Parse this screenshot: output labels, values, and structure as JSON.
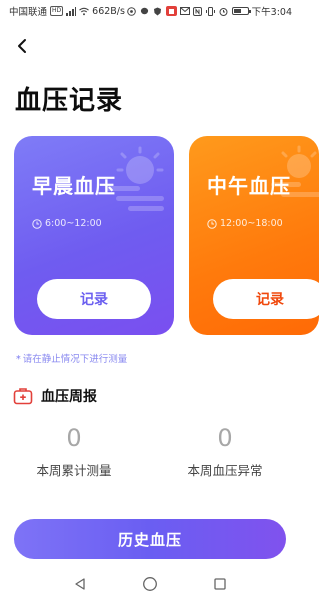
{
  "status_bar": {
    "carrier": "中国联通",
    "carrier_chip": "HD",
    "net_speed": "662B/s",
    "time": "下午3:04",
    "battery_level": 0.6
  },
  "header": {
    "title": "血压记录"
  },
  "cards": [
    {
      "title": "早晨血压",
      "time": "6:00~12:00",
      "button": "记录",
      "accent": "#6f5cf0"
    },
    {
      "title": "中午血压",
      "time": "12:00~18:00",
      "button": "记录",
      "accent": "#ff7a0c"
    }
  ],
  "hint": {
    "star": "*",
    "text": "请在静止情况下进行测量"
  },
  "weekly": {
    "title": "血压周报",
    "stats": [
      {
        "value": "0",
        "label": "本周累计测量"
      },
      {
        "value": "0",
        "label": "本周血压异常"
      }
    ]
  },
  "history_button": "历史血压",
  "colors": {
    "primary": "#6a5ef2",
    "orange": "#ff7a0c",
    "hint": "#8a8af0",
    "weekly_icon": "#e2403a"
  }
}
